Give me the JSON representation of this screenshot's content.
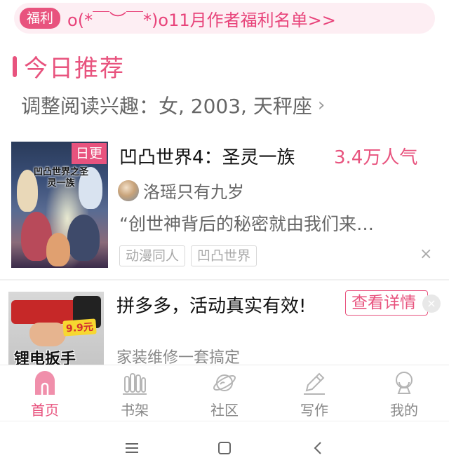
{
  "promo": {
    "badge": "福利",
    "text": "o(*￣︶￣*)o11月作者福利名单>>"
  },
  "section": {
    "title": "今日推荐"
  },
  "interest": {
    "text": "调整阅读兴趣：女, 2003, 天秤座",
    "chevron": "›"
  },
  "book": {
    "badge": "日更",
    "cover_text": "凹凸世界之圣灵一族",
    "title": "凹凸世界4：圣灵一族",
    "popularity": "3.4万人气",
    "author": "洛瑶只有九岁",
    "description": "“创世神背后的秘密就由我们来…",
    "tags": [
      "动漫同人",
      "凹凸世界"
    ],
    "close": "×"
  },
  "ad": {
    "product_text": "锂电扳手",
    "price_tag": "9.9元",
    "title": "拼多多，活动真实有效!",
    "button": "查看详情",
    "close": "×",
    "description": "家装维修一套搞定"
  },
  "nav": {
    "items": [
      {
        "label": "首页",
        "icon": "home-icon",
        "active": true
      },
      {
        "label": "书架",
        "icon": "bookshelf-icon",
        "active": false
      },
      {
        "label": "社区",
        "icon": "community-planet-icon",
        "active": false
      },
      {
        "label": "写作",
        "icon": "pen-icon",
        "active": false
      },
      {
        "label": "我的",
        "icon": "profile-icon",
        "active": false
      }
    ]
  },
  "colors": {
    "accent": "#e8537e",
    "promo_bg": "#fdeef3",
    "text_secondary": "#666666",
    "icon_gray": "#aaaaaa"
  }
}
